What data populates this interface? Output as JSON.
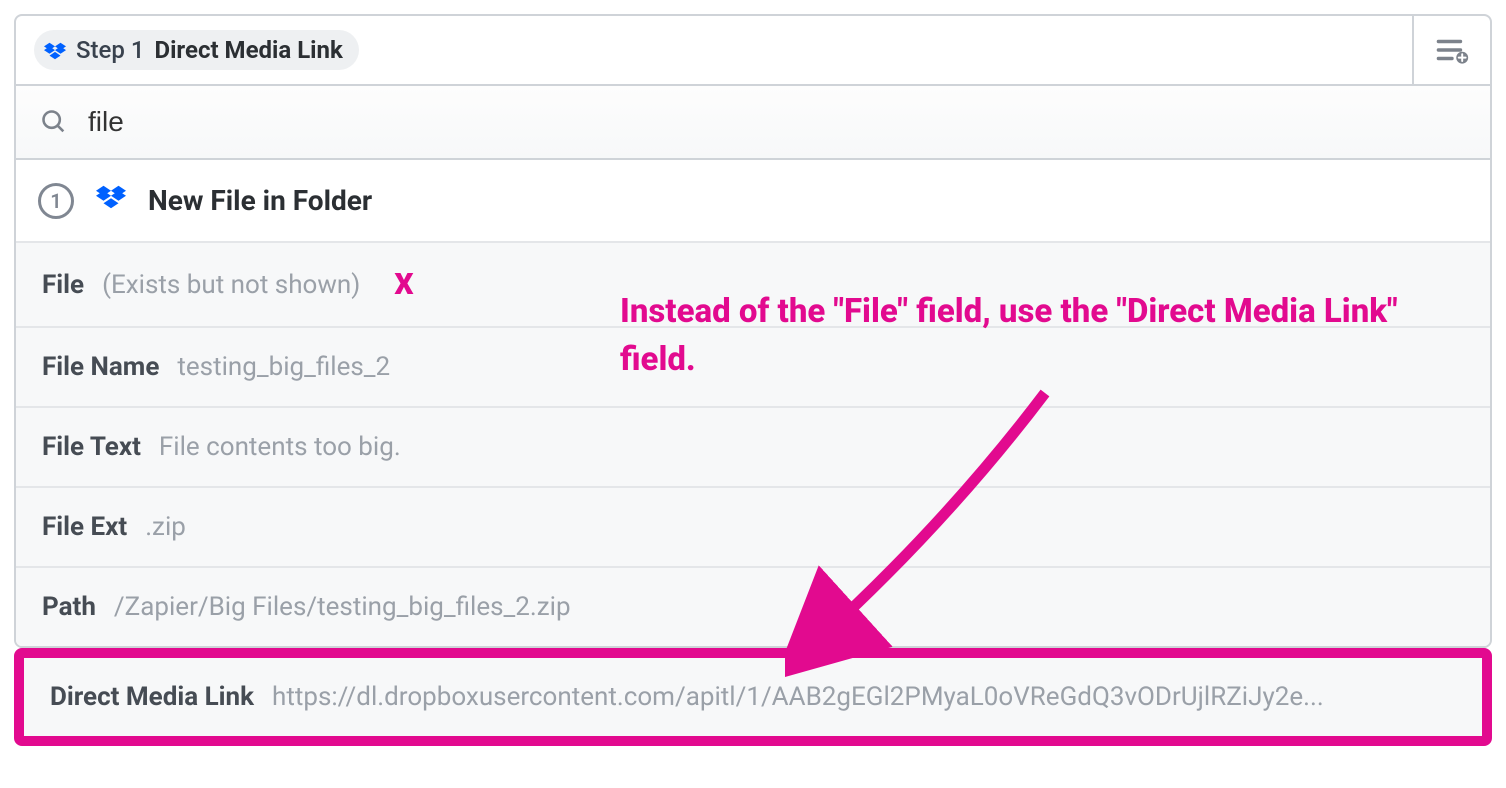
{
  "pill": {
    "step_label": "Step 1",
    "step_value": "Direct Media Link"
  },
  "search": {
    "value": "file"
  },
  "source": {
    "number": "1",
    "title": "New File in Folder"
  },
  "annotation": {
    "text": "Instead of the \"File\" field, use the \"Direct Media Link\" field.",
    "x_mark": "X"
  },
  "fields": [
    {
      "name": "File",
      "value": "(Exists but not shown)"
    },
    {
      "name": "File Name",
      "value": "testing_big_files_2"
    },
    {
      "name": "File Text",
      "value": "File contents too big."
    },
    {
      "name": "File Ext",
      "value": ".zip"
    },
    {
      "name": "Path",
      "value": "/Zapier/Big Files/testing_big_files_2.zip"
    },
    {
      "name": "Direct Media Link",
      "value": "https://dl.dropboxusercontent.com/apitl/1/AAB2gEGl2PMyaL0oVReGdQ3vODrUjlRZiJy2e..."
    }
  ]
}
